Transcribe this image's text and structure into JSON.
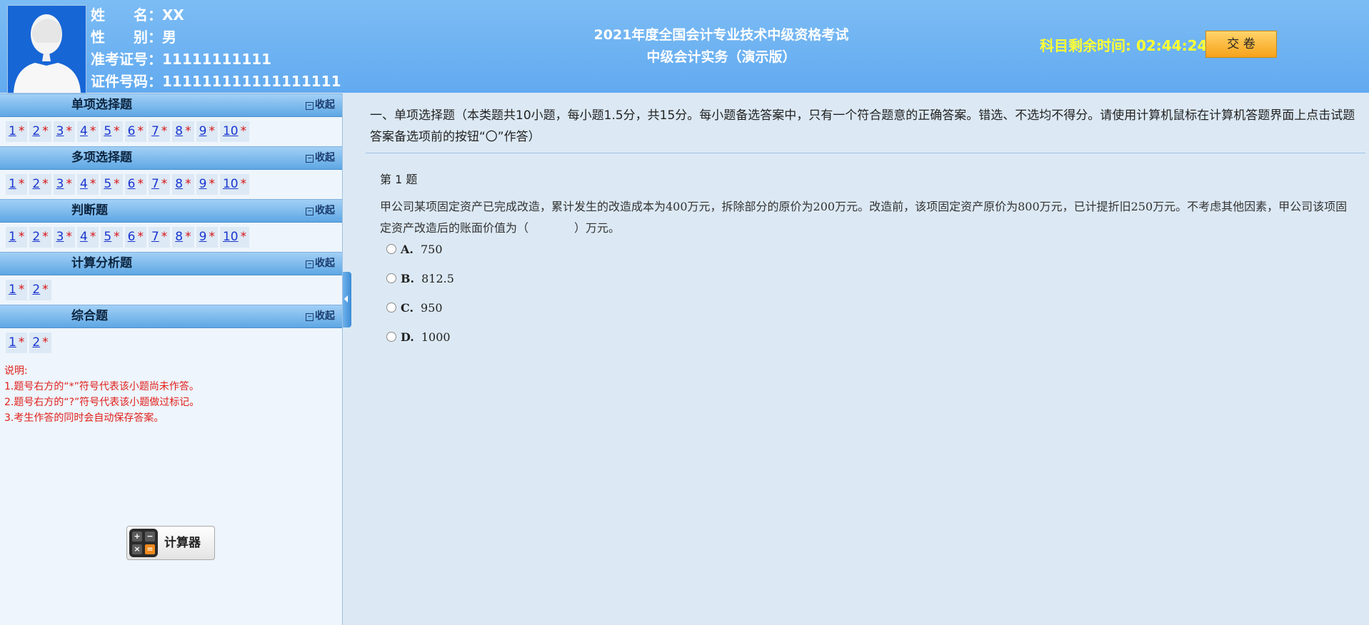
{
  "candidate": {
    "name_label": "姓　　名：",
    "name": "XX",
    "gender_label": "性　　别：",
    "gender": "男",
    "exam_id_label": "准考证号：",
    "exam_id": "11111111111",
    "cert_label": "证件号码：",
    "cert_number": "111111111111111111"
  },
  "exam": {
    "title": "2021年度全国会计专业技术中级资格考试",
    "subtitle": "中级会计实务（演示版）"
  },
  "timer": {
    "label": "科目剩余时间:",
    "value": "02:44:24"
  },
  "submit_label": "交 卷",
  "sidebar": {
    "collapse_label": "收起",
    "sections": [
      {
        "title": "单项选择题",
        "questions": [
          "1",
          "2",
          "3",
          "4",
          "5",
          "6",
          "7",
          "8",
          "9",
          "10"
        ]
      },
      {
        "title": "多项选择题",
        "questions": [
          "1",
          "2",
          "3",
          "4",
          "5",
          "6",
          "7",
          "8",
          "9",
          "10"
        ]
      },
      {
        "title": "判断题",
        "questions": [
          "1",
          "2",
          "3",
          "4",
          "5",
          "6",
          "7",
          "8",
          "9",
          "10"
        ]
      },
      {
        "title": "计算分析题",
        "questions": [
          "1",
          "2"
        ]
      },
      {
        "title": "综合题",
        "questions": [
          "1",
          "2"
        ]
      }
    ],
    "unanswered_mark": "*",
    "notes": [
      "说明:",
      "1.题号右方的“*”符号代表该小题尚未作答。",
      "2.题号右方的“?”符号代表该小题做过标记。",
      "3.考生作答的同时会自动保存答案。"
    ],
    "calculator_label": "计算器"
  },
  "main": {
    "instruction": "一、单项选择题（本类题共10小题，每小题1.5分，共15分。每小题备选答案中，只有一个符合题意的正确答案。错选、不选均不得分。请使用计算机鼠标在计算机答题界面上点击试题答案备选项前的按钮“〇”作答）",
    "question_title": "第 1 题",
    "question_text": "甲公司某项固定资产已完成改造，累计发生的改造成本为400万元，拆除部分的原价为200万元。改造前，该项固定资产原价为800万元，已计提折旧250万元。不考虑其他因素，甲公司该项固定资产改造后的账面价值为（　　　　）万元。",
    "options": [
      {
        "key": "A.",
        "text": "750"
      },
      {
        "key": "B.",
        "text": "812.5"
      },
      {
        "key": "C.",
        "text": "950"
      },
      {
        "key": "D.",
        "text": "1000"
      }
    ]
  },
  "colors": {
    "header_bg": "#6eb4f2",
    "timer": "#ffff33",
    "link": "#1a36d0",
    "asterisk": "#d81414",
    "notes": "#e0201b",
    "submit_bg": "#f7a21a"
  }
}
